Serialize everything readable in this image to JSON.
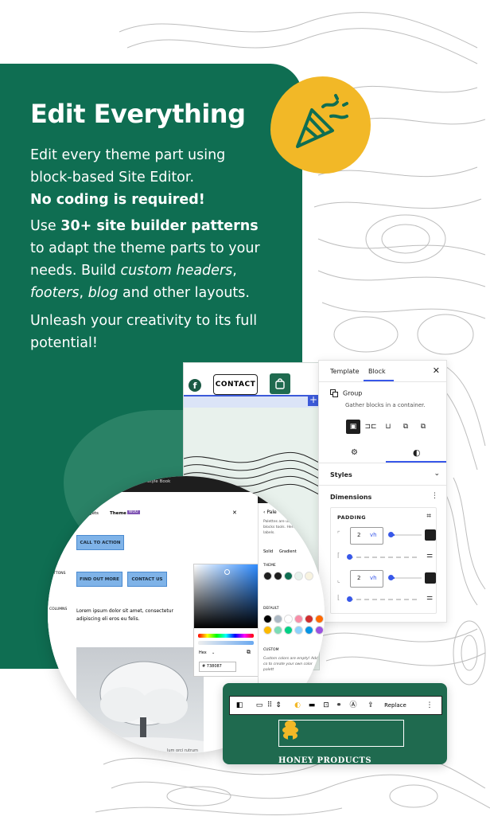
{
  "hero": {
    "title": "Edit Everything",
    "p1_line": "Edit every theme part using block-based Site Editor.",
    "p1_bold": "No coding is required!",
    "p2_pre": "Use ",
    "p2_bold": "30+ site builder patterns",
    "p2_mid": " to adapt the theme parts to your needs. Build ",
    "p2_i1": "custom headers",
    "p2_c1": ", ",
    "p2_i2": "footers",
    "p2_c2": ", ",
    "p2_i3": "blog",
    "p2_end": " and other layouts.",
    "p3": "Unleash your creativity to its full potential!"
  },
  "colors": {
    "green": "#0f6e52",
    "yellow": "#f2b827",
    "accent_blue": "#3858e9"
  },
  "phone": {
    "contact_label": "CONTACT",
    "fb_glyph": "f",
    "plus": "+"
  },
  "panel": {
    "tab_template": "Template",
    "tab_block": "Block",
    "close": "✕",
    "group_title": "Group",
    "group_desc": "Gather blocks in a container.",
    "styles_label": "Styles",
    "dimensions_label": "Dimensions",
    "padding_label": "PADDING",
    "padding_value_1": "2",
    "padding_unit_1": "vh",
    "padding_value_2": "2",
    "padding_unit_2": "vh"
  },
  "zoom": {
    "style_book": "Style Book",
    "tab_blocks": "gets",
    "tab_theme": "Theme",
    "badge": "WOO",
    "btn_call": "CALL TO ACTION",
    "btn_find": "FIND OUT MORE",
    "btn_contact": "CONTACT US",
    "label_buttons": "UTTONS",
    "label_columns": "COLUMNS",
    "lorem": "Lorem ipsum dolor sit amet, consectetur adipiscing eli eros eu felis.",
    "palette_title": "Pale",
    "palette_desc": "Palettes are use options for blocks tools. Here you ca their labels.",
    "solid": "Solid",
    "gradient": "Gradient",
    "theme_label": "THEME",
    "default_label": "DEFAULT",
    "custom_label": "CUSTOM",
    "custom_desc": "Custom colors are empty! Add co to create your own color palett",
    "hex_label": "Hex",
    "hex_value": "# 738087",
    "bottom_text": "lum orci rutrum",
    "theme_colors": [
      "#1e1e1e",
      "#1e1e1e",
      "#0f6e52",
      "#e8f1ec",
      "#f8f3e0"
    ],
    "default_colors": [
      "#000000",
      "#abb8c3",
      "#ffffff",
      "#f78da7",
      "#cf2e2e",
      "#ff6900",
      "#fcb900",
      "#7bdcb5",
      "#00d084",
      "#8ed1fc",
      "#0693e3",
      "#9b51e0"
    ]
  },
  "toolbar": {
    "replace_label": "Replace",
    "more": "⋮",
    "honey_title": "HONEY PRODUCTS"
  }
}
